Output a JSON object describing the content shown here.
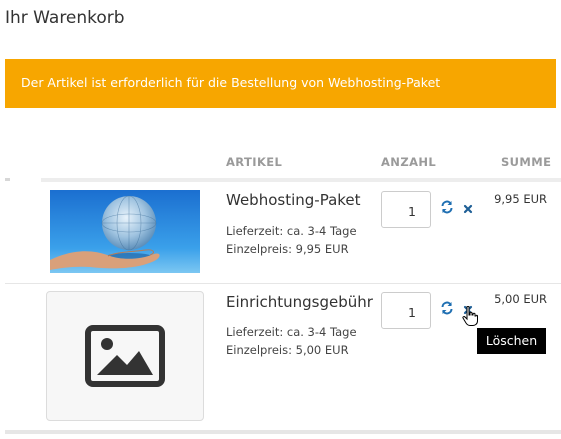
{
  "page": {
    "title": "Ihr Warenkorb"
  },
  "alert": {
    "message": "Der Artikel ist erforderlich für die Bestellung von Webhosting-Paket",
    "color": "#f7a600"
  },
  "table": {
    "headers": {
      "article": "ARTIKEL",
      "quantity": "ANZAHL",
      "sum": "SUMME"
    },
    "rows": [
      {
        "name": "Webhosting-Paket",
        "delivery": "Lieferzeit: ca. 3-4 Tage",
        "unit_price": "Einzelpreis: 9,95 EUR",
        "quantity": "1",
        "sum": "9,95 EUR",
        "image": "hand-holding-globe-photo"
      },
      {
        "name": "Einrichtungsgebühr",
        "delivery": "Lieferzeit: ca. 3-4 Tage",
        "unit_price": "Einzelpreis: 5,00 EUR",
        "quantity": "1",
        "sum": "5,00 EUR",
        "image": "image-placeholder-icon"
      }
    ]
  },
  "tooltip": {
    "text": "Löschen"
  },
  "icons": {
    "refresh": "refresh-icon",
    "delete": "close-icon",
    "accent": "#1f6fb2"
  }
}
